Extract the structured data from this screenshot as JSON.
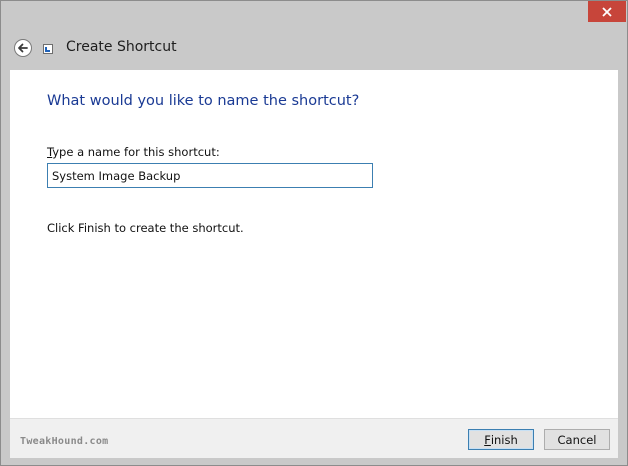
{
  "window": {
    "title": "Create Shortcut"
  },
  "content": {
    "heading": "What would you like to name the shortcut?",
    "field_label_accel": "T",
    "field_label_rest": "ype a name for this shortcut:",
    "name_value": "System Image Backup",
    "hint": "Click Finish to create the shortcut."
  },
  "footer": {
    "watermark": "TweakHound.com",
    "finish_accel": "F",
    "finish_rest": "inish",
    "cancel_label": "Cancel"
  },
  "icons": {
    "back": "back-arrow-icon",
    "shortcut": "shortcut-icon",
    "close": "close-icon"
  },
  "colors": {
    "close_button": "#c7453a",
    "heading": "#1a3a94",
    "focus_border": "#3c7fb1"
  }
}
